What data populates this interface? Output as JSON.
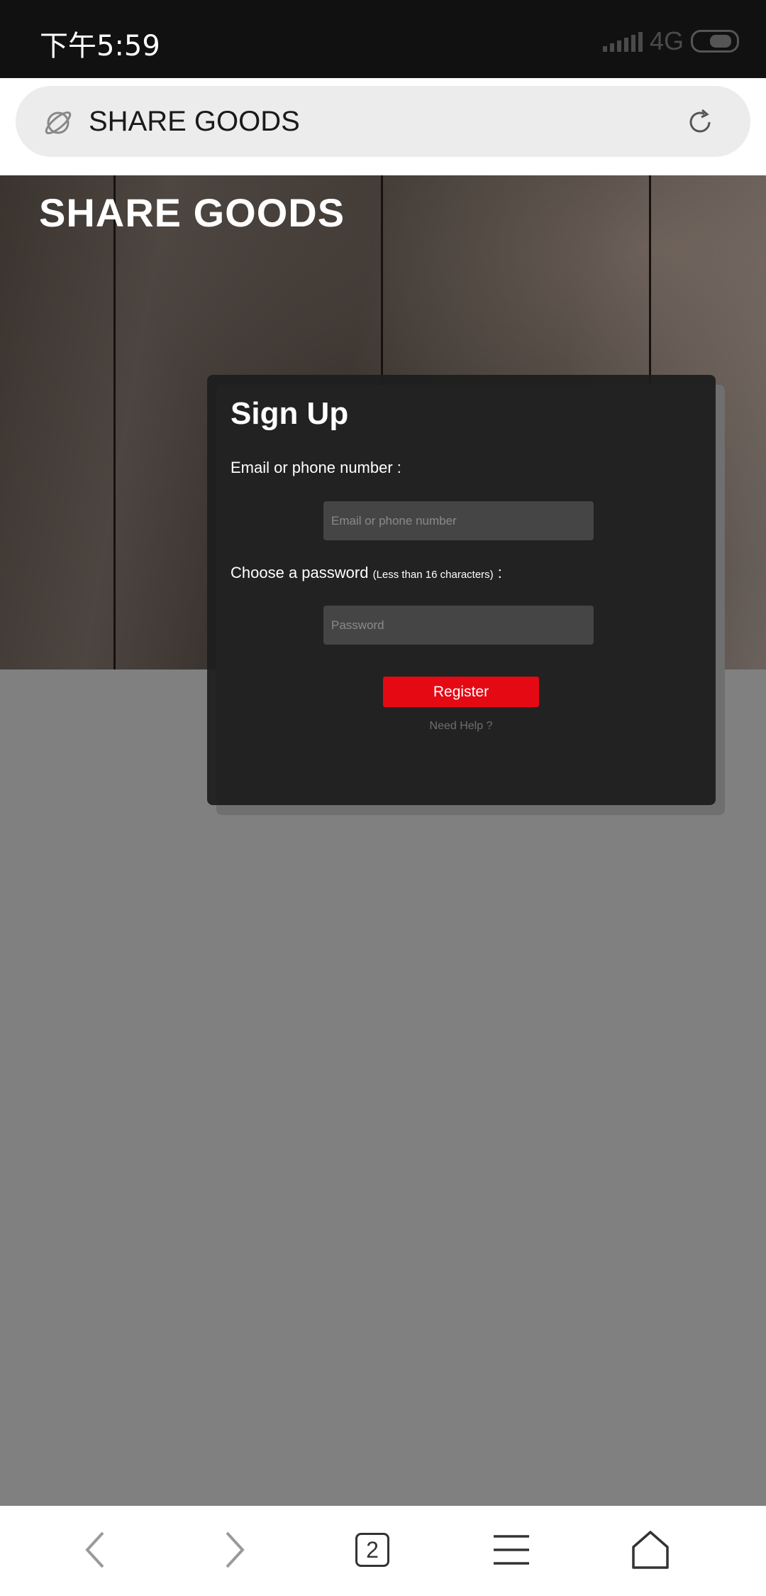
{
  "status_bar": {
    "time": "下午5:59",
    "network": "4G"
  },
  "address_bar": {
    "icon": "planet-icon",
    "url_text": "SHARE GOODS",
    "reload_icon": "reload-icon"
  },
  "hero": {
    "site_title": "SHARE GOODS"
  },
  "signup": {
    "title": "Sign Up",
    "email_label": "Email or phone number :",
    "email_placeholder": "Email or phone number",
    "password_label": "Choose a password",
    "password_hint": "(Less than 16 characters)",
    "password_colon": " :",
    "password_placeholder": "Password",
    "register_label": "Register",
    "help_link": "Need Help ?"
  },
  "bottom_nav": {
    "tab_count": "2",
    "items": [
      "back-icon",
      "forward-icon",
      "tabs-icon",
      "menu-icon",
      "home-icon"
    ]
  },
  "colors": {
    "accent": "#e50914",
    "card_bg": "#1e1e1e",
    "page_bg": "#808080"
  }
}
